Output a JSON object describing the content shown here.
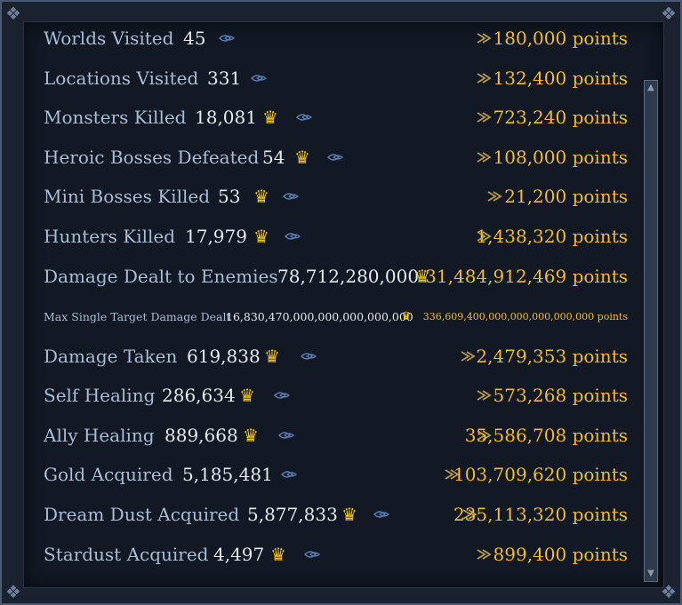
{
  "stats": [
    {
      "label": "Worlds Visited",
      "value": "45",
      "crown": false,
      "points": "180,000 points"
    },
    {
      "label": "Locations Visited",
      "value": "331",
      "crown": false,
      "points": "132,400 points"
    },
    {
      "label": "Monsters Killed",
      "value": "18,081",
      "crown": true,
      "points": "723,240 points"
    },
    {
      "label": "Heroic Bosses Defeated",
      "value": "54",
      "crown": true,
      "points": "108,000 points"
    },
    {
      "label": "Mini Bosses Killed",
      "value": "53",
      "crown": true,
      "points": "21,200 points"
    },
    {
      "label": "Hunters Killed",
      "value": "17,979",
      "crown": true,
      "points": "1,438,320 points"
    },
    {
      "label": "Damage Dealt to Enemies",
      "value": "78,712,280,000",
      "crown": true,
      "points": "31,484,912,469 points"
    },
    {
      "label": "Max Single Target Damage Dealt",
      "value": "16,830,470,000,000,000,000,000",
      "crown": true,
      "points": "336,609,400,000,000,000,000,000 points"
    },
    {
      "label": "Damage Taken",
      "value": "619,838",
      "crown": true,
      "points": "2,479,353 points"
    },
    {
      "label": "Self Healing",
      "value": "286,634",
      "crown": true,
      "points": "573,268 points"
    },
    {
      "label": "Ally Healing",
      "value": "889,668",
      "crown": true,
      "points": "35,586,708 points"
    },
    {
      "label": "Gold Acquired",
      "value": "5,185,481",
      "crown": false,
      "points": "103,709,620 points"
    },
    {
      "label": "Dream Dust Acquired",
      "value": "5,877,833",
      "crown": true,
      "points": "235,113,320 points"
    },
    {
      "label": "Stardust Acquired",
      "value": "4,497",
      "crown": true,
      "points": "899,400 points"
    }
  ],
  "icons": {
    "crown": "♛",
    "arrow": "arrow-icon",
    "scroll_up": "▲",
    "scroll_down": "▼"
  },
  "colors": {
    "label": "#a9bdd6",
    "value": "#e6e9ee",
    "points": "#f2bc2a",
    "crown": "#f3c316",
    "arrow_blue": "#5a7fb8",
    "arrow_gold": "#b89c4a"
  }
}
